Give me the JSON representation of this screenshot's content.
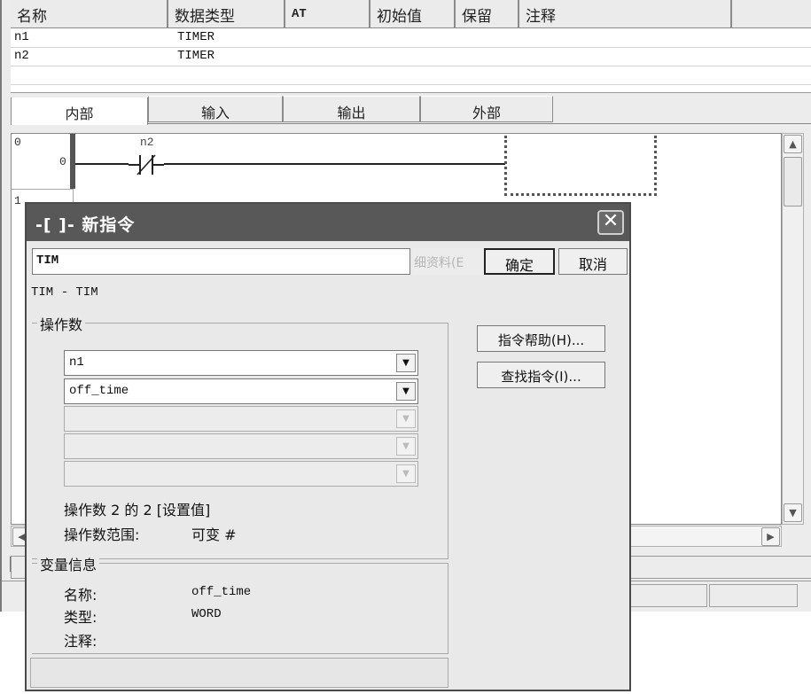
{
  "var_table": {
    "headers": [
      "名称",
      "数据类型",
      "AT",
      "初始值",
      "保留",
      "注释"
    ],
    "rows": [
      {
        "name": "n1",
        "type": "TIMER"
      },
      {
        "name": "n2",
        "type": "TIMER"
      }
    ]
  },
  "tabs": [
    "内部",
    "输入",
    "输出",
    "外部"
  ],
  "ladder": {
    "rungs": [
      "0",
      "1"
    ],
    "step": "0",
    "contact_label": "n2"
  },
  "dialog": {
    "title": "-[ ]- 新指令",
    "close_glyph": "✕",
    "instruction_value": "TIM",
    "detail_button": "细资料(E",
    "ok": "确定",
    "cancel": "取消",
    "description": "TIM - TIM",
    "operands": {
      "label": "操作数",
      "values": [
        "n1",
        "off_time",
        "",
        "",
        ""
      ],
      "status": "操作数 2 的 2 [设置值]",
      "range_label": "操作数范围:",
      "range_value": "可变 #"
    },
    "help_button": "指令帮助(H)...",
    "find_button": "查找指令(I)...",
    "var_info": {
      "label": "变量信息",
      "name_label": "名称:",
      "name_value": "off_time",
      "type_label": "类型:",
      "type_value": "WORD",
      "comment_label": "注释:"
    }
  },
  "icons": {
    "scroll_up": "▲",
    "scroll_down": "▼",
    "scroll_left": "◀",
    "scroll_right": "▶",
    "dropdown": "▼",
    "panel_close": "✕"
  }
}
